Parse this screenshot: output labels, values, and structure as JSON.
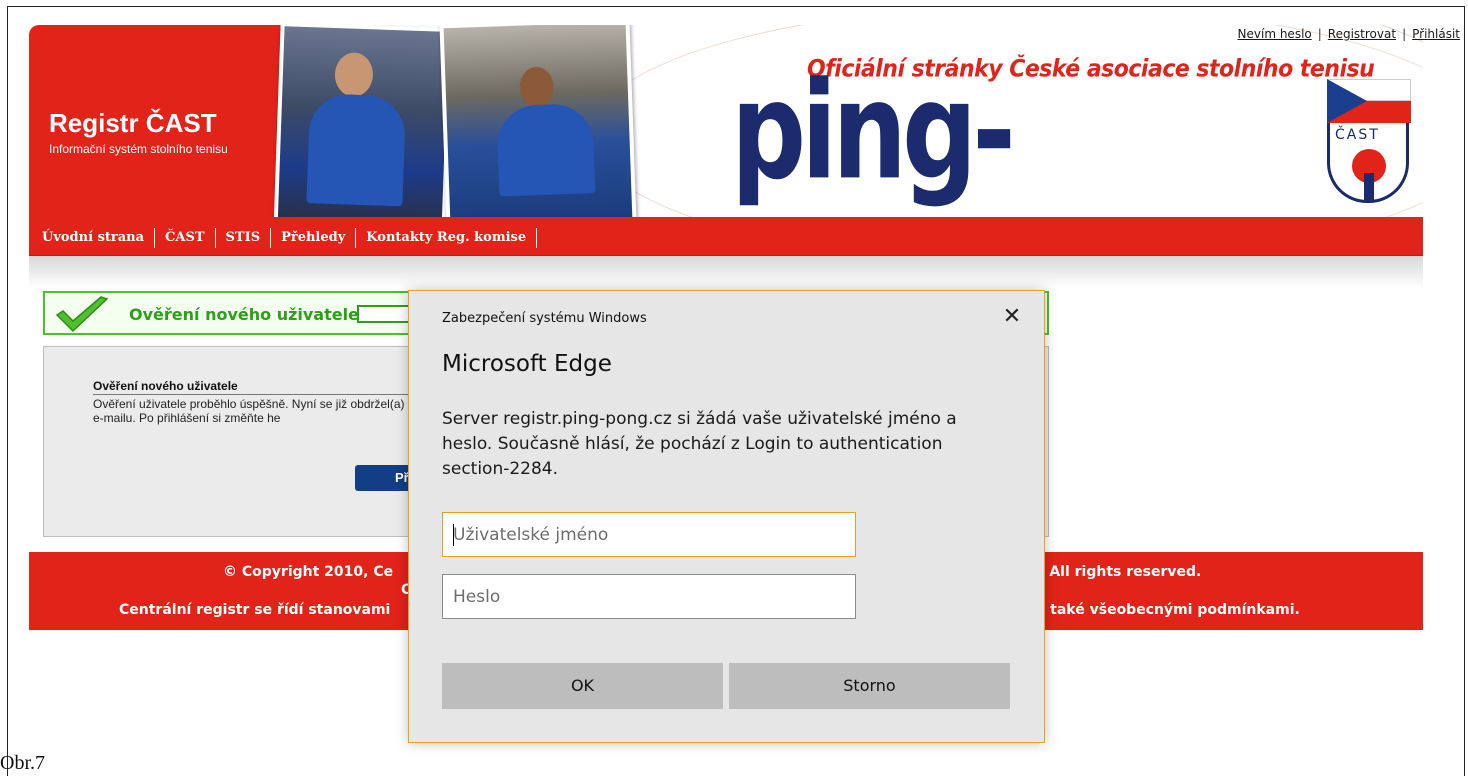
{
  "top_links": {
    "forgot": "Nevím heslo",
    "register": "Registrovat",
    "login": "Přihlásit",
    "sep": "|"
  },
  "brand": {
    "title": "Registr ČAST",
    "subtitle": "Informační systém stolního tenisu"
  },
  "header": {
    "official": "Oficiální stránky České asociace stolního tenisu",
    "logo": "ping-pong.cz",
    "shield_text": "ČAST"
  },
  "nav": {
    "items": [
      "Úvodní strana",
      "ČAST",
      "STIS",
      "Přehledy",
      "Kontakty Reg. komise"
    ]
  },
  "banner": {
    "title": "Ověření nového uživatele",
    "icon": "checkmark-icon",
    "color": "#2ba11a"
  },
  "panel": {
    "title": "Ověření nového uživatele",
    "text": "Ověření uživatele proběhlo úspěšně. Nyní se již obdržel(a) v e-mailu. Po přihlášení si změňte he",
    "button": "Př"
  },
  "footer": {
    "l1a": "© Copyright 2010, Ce",
    "l1b": "z. All rights reserved.",
    "l2a": "C",
    "l2b": ",",
    "l3a": "Centrální registr se řídí stanovami",
    "l3b": "le také všeobecnými podmínkami."
  },
  "dialog": {
    "caption": "Zabezpečení systému Windows",
    "close": "✕",
    "title": "Microsoft Edge",
    "message": "Server registr.ping-pong.cz si žádá vaše uživatelské jméno a heslo. Současně hlásí, že pochází z Login to authentication section-2284.",
    "username_placeholder": "Uživatelské jméno",
    "password_placeholder": "Heslo",
    "ok": "OK",
    "cancel": "Storno"
  },
  "caption": "Obr.7",
  "colors": {
    "red": "#e2231a",
    "navy": "#1c2b6e",
    "dialog_accent": "#e8a11e"
  }
}
